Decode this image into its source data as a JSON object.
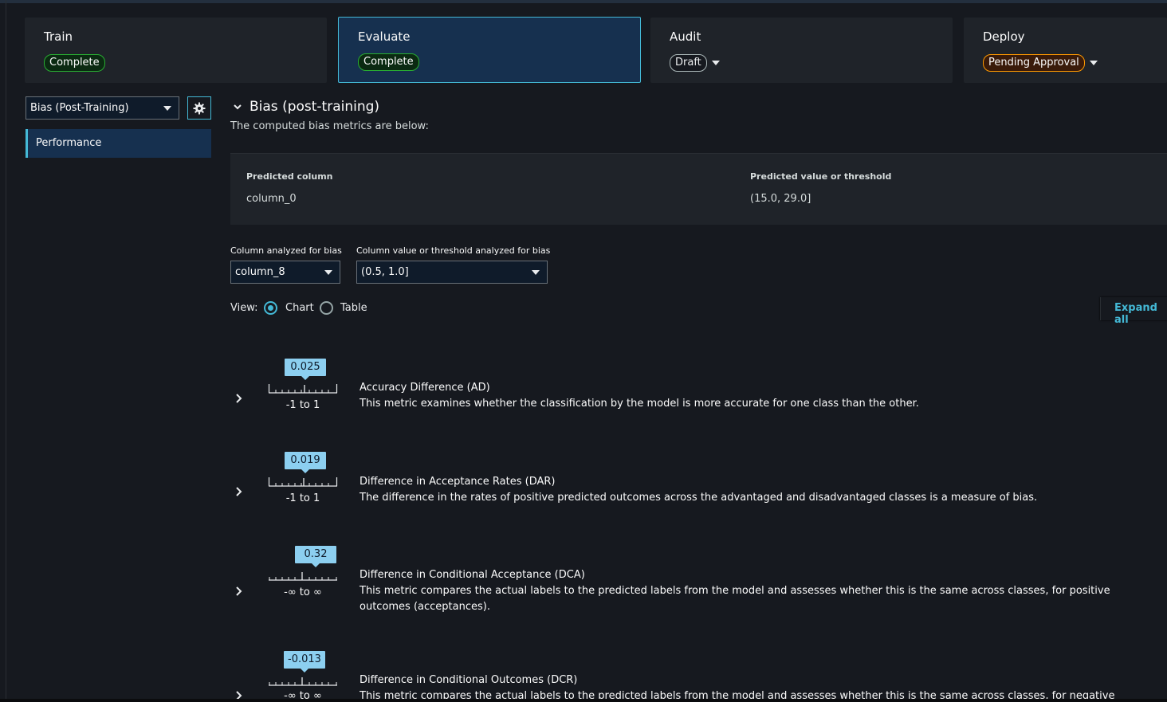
{
  "stages": [
    {
      "title": "Train",
      "status": "Complete"
    },
    {
      "title": "Evaluate",
      "status": "Complete"
    },
    {
      "title": "Audit",
      "status": "Draft"
    },
    {
      "title": "Deploy",
      "status": "Pending Approval"
    }
  ],
  "sidebar": {
    "report_select": "Bias (Post-Training)",
    "nav_item": "Performance"
  },
  "section": {
    "title": "Bias (post-training)",
    "description": "The computed bias metrics are below:"
  },
  "info": {
    "predicted_column_label": "Predicted column",
    "predicted_column_value": "column_0",
    "predicted_threshold_label": "Predicted value or threshold",
    "predicted_threshold_value": "(15.0, 29.0]"
  },
  "filters": {
    "column_label": "Column analyzed for bias",
    "column_value": "column_8",
    "threshold_label": "Column value or threshold analyzed for bias",
    "threshold_value": "(0.5, 1.0]"
  },
  "view": {
    "label": "View:",
    "chart": "Chart",
    "table": "Table",
    "selected": "chart"
  },
  "expand_all": "Expand all",
  "metrics": [
    {
      "value": "0.025",
      "range": "-1 to 1",
      "name": "Accuracy Difference (AD)",
      "description": "This metric examines whether the classification by the model is more accurate for one class than the other."
    },
    {
      "value": "0.019",
      "range": "-1 to 1",
      "name": "Difference in Acceptance Rates (DAR)",
      "description": "The difference in the rates of positive predicted outcomes across the advantaged and disadvantaged classes is a measure of bias."
    },
    {
      "value": "0.32",
      "range": "-∞ to ∞",
      "name": "Difference in Conditional Acceptance (DCA)",
      "description": "This metric compares the actual labels to the predicted labels from the model and assesses whether this is the same across classes, for positive outcomes (acceptances)."
    },
    {
      "value": "-0.013",
      "range": "-∞ to ∞",
      "name": "Difference in Conditional Outcomes (DCR)",
      "description": "This metric compares the actual labels to the predicted labels from the model and assesses whether this is the same across classes, for negative"
    }
  ],
  "colors": {
    "accent": "#44b9d6",
    "complete": "#29ad32",
    "pending": "#ff9900",
    "value_box": "#8ccff0"
  }
}
